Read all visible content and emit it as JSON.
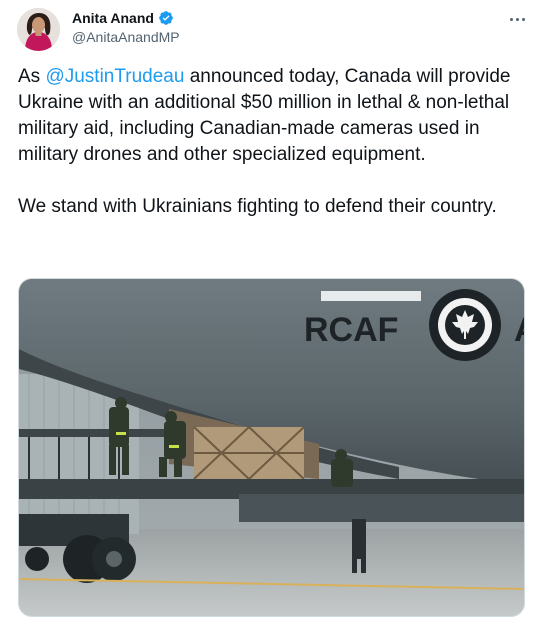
{
  "author": {
    "name": "Anita Anand",
    "handle": "@AnitaAnandMP",
    "verified_icon": "verified-badge-icon"
  },
  "tweet": {
    "text_before_mention": "As ",
    "mention": "@JustinTrudeau",
    "text_after_mention": " announced today, Canada will provide Ukraine with an additional $50 million in lethal & non-lethal military aid, including Canadian-made cameras used in military drones and other specialized equipment.",
    "paragraph_2": "We stand with Ukrainians fighting to defend their country."
  },
  "media": {
    "aircraft_marking": "RCAF",
    "aircraft_marking_partial": "A"
  },
  "colors": {
    "link": "#1d9bf0",
    "text": "#0f1419",
    "secondary": "#536471",
    "verified": "#1d9bf0"
  }
}
